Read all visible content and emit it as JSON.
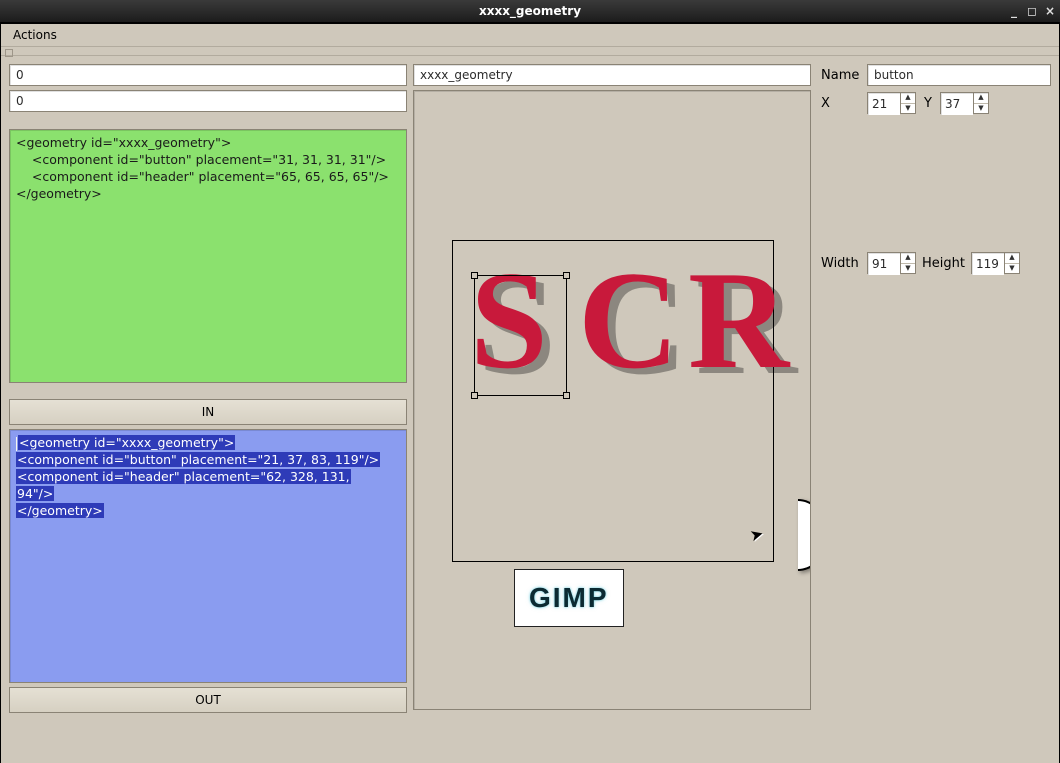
{
  "window": {
    "title": "xxxx_geometry"
  },
  "menu": {
    "actions": "Actions"
  },
  "left": {
    "field1": "0",
    "field2": "0",
    "in_text": "<geometry id=\"xxxx_geometry\">\n    <component id=\"button\" placement=\"31, 31, 31, 31\"/>\n    <component id=\"header\" placement=\"65, 65, 65, 65\"/>\n</geometry>",
    "in_btn": "IN",
    "out_line1": "<geometry id=\"xxxx_geometry\">",
    "out_line2": "    <component id=\"button\" placement=\"21, 37, 83, 119\"/>",
    "out_line3a": "    <component id=\"header\" placement=\"62, 328, 131,",
    "out_line3b": "94\"/>",
    "out_line4": "</geometry>",
    "out_btn": "OUT"
  },
  "mid": {
    "field": "xxxx_geometry",
    "scr": "SCR",
    "gimp": "GIMP"
  },
  "props": {
    "name_label": "Name",
    "name_value": "button",
    "x_label": "X",
    "x_value": "21",
    "y_label": "Y",
    "y_value": "37",
    "width_label": "Width",
    "width_value": "91",
    "height_label": "Height",
    "height_value": "119"
  }
}
